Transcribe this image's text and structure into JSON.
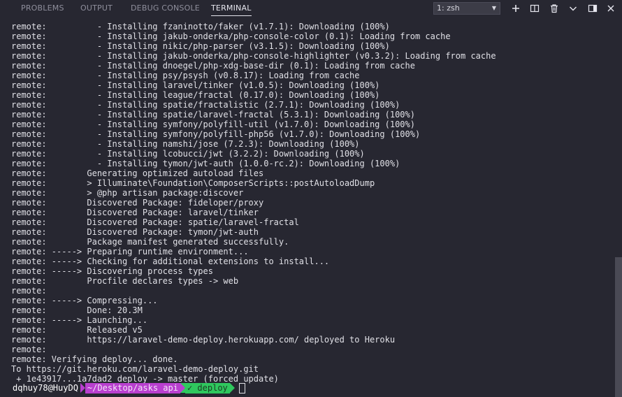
{
  "panel": {
    "tabs": [
      {
        "label": "PROBLEMS"
      },
      {
        "label": "OUTPUT"
      },
      {
        "label": "DEBUG CONSOLE"
      },
      {
        "label": "TERMINAL"
      }
    ],
    "active_tab": "TERMINAL",
    "shell_select": {
      "value": "1: zsh"
    },
    "actions": [
      "plus-icon",
      "split-terminal-icon",
      "trash-icon",
      "chevron-down-icon",
      "toggle-maximize-icon",
      "close-icon"
    ]
  },
  "terminal": {
    "lines": [
      "remote:          - Installing fzaninotto/faker (v1.7.1): Downloading (100%)",
      "remote:          - Installing jakub-onderka/php-console-color (0.1): Loading from cache",
      "remote:          - Installing nikic/php-parser (v3.1.5): Downloading (100%)",
      "remote:          - Installing jakub-onderka/php-console-highlighter (v0.3.2): Loading from cache",
      "remote:          - Installing dnoegel/php-xdg-base-dir (0.1): Loading from cache",
      "remote:          - Installing psy/psysh (v0.8.17): Loading from cache",
      "remote:          - Installing laravel/tinker (v1.0.5): Downloading (100%)",
      "remote:          - Installing league/fractal (0.17.0): Downloading (100%)",
      "remote:          - Installing spatie/fractalistic (2.7.1): Downloading (100%)",
      "remote:          - Installing spatie/laravel-fractal (5.3.1): Downloading (100%)",
      "remote:          - Installing symfony/polyfill-util (v1.7.0): Downloading (100%)",
      "remote:          - Installing symfony/polyfill-php56 (v1.7.0): Downloading (100%)",
      "remote:          - Installing namshi/jose (7.2.3): Downloading (100%)",
      "remote:          - Installing lcobucci/jwt (3.2.2): Downloading (100%)",
      "remote:          - Installing tymon/jwt-auth (1.0.0-rc.2): Downloading (100%)",
      "remote:        Generating optimized autoload files",
      "remote:        > Illuminate\\Foundation\\ComposerScripts::postAutoloadDump",
      "remote:        > @php artisan package:discover",
      "remote:        Discovered Package: fideloper/proxy",
      "remote:        Discovered Package: laravel/tinker",
      "remote:        Discovered Package: spatie/laravel-fractal",
      "remote:        Discovered Package: tymon/jwt-auth",
      "remote:        Package manifest generated successfully.",
      "remote: -----> Preparing runtime environment...",
      "remote: -----> Checking for additional extensions to install...",
      "remote: -----> Discovering process types",
      "remote:        Procfile declares types -> web",
      "remote:",
      "remote: -----> Compressing...",
      "remote:        Done: 20.3M",
      "remote: -----> Launching...",
      "remote:        Released v5",
      "remote:        https://laravel-demo-deploy.herokuapp.com/ deployed to Heroku",
      "remote:",
      "remote: Verifying deploy... done.",
      "To https://git.heroku.com/laravel-demo-deploy.git",
      " + 1e43917...1a7dad2 deploy -> master (forced update)"
    ],
    "prompt": {
      "user": "dqhuy78@HuyDQ",
      "dir": "~/Desktop/asks api",
      "git": "✓ deploy"
    }
  }
}
